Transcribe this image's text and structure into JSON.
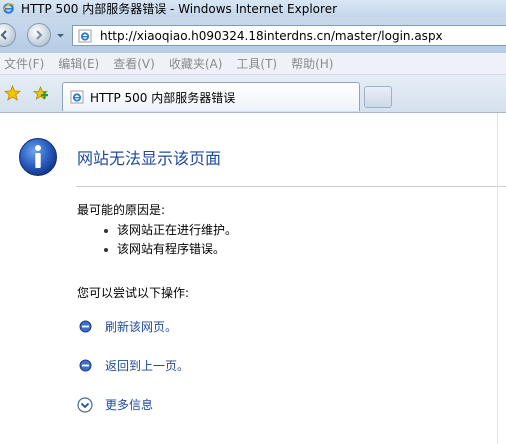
{
  "window": {
    "title": "HTTP 500 内部服务器错误 - Windows Internet Explorer"
  },
  "address_bar": {
    "url": "http://xiaoqiao.h090324.18interdns.cn/master/login.aspx"
  },
  "menu": {
    "items": [
      "文件(F)",
      "编辑(E)",
      "查看(V)",
      "收藏夹(A)",
      "工具(T)",
      "帮助(H)"
    ]
  },
  "tabs": [
    {
      "label": "HTTP 500 内部服务器错误"
    }
  ],
  "content": {
    "title": "网站无法显示该页面",
    "cause_heading": "最可能的原因是:",
    "causes": [
      "该网站正在进行维护。",
      "该网站有程序错误。"
    ],
    "try_heading": "您可以尝试以下操作:",
    "actions": {
      "refresh": "刷新该网页。",
      "back": "返回到上一页。",
      "more_info": "更多信息"
    }
  },
  "colors": {
    "link": "#1f4a9c",
    "title": "#1f4a9c",
    "menu_text": "#8a8a8a"
  },
  "icons": {
    "title_bar": "ie-icon",
    "back": "back-arrow-icon",
    "forward": "forward-arrow-icon",
    "page": "ie-page-icon",
    "favorites": "favorites-star-icon",
    "add_favorites": "add-favorites-icon",
    "info": "info-icon",
    "bullet": "blue-bullet-icon",
    "more": "chevron-down-circle-icon"
  }
}
